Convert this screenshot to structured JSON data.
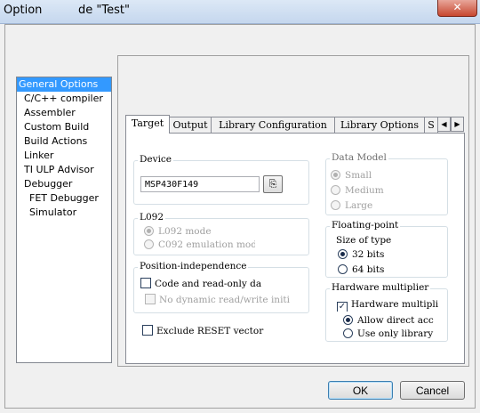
{
  "window": {
    "title_left": "Option",
    "title_right": "de \"Test\"",
    "close_glyph": "✕"
  },
  "categories": [
    {
      "label": "General Options",
      "selected": true
    },
    {
      "label": "C/C++ compiler"
    },
    {
      "label": "Assembler"
    },
    {
      "label": "Custom Build"
    },
    {
      "label": "Build Actions"
    },
    {
      "label": "Linker"
    },
    {
      "label": "TI ULP Advisor"
    },
    {
      "label": "Debugger"
    },
    {
      "label": "FET Debugger",
      "indent": true
    },
    {
      "label": "Simulator",
      "indent": true
    }
  ],
  "tabs": [
    "Target",
    "Output",
    "Library Configuration",
    "Library Options",
    "S"
  ],
  "tab_scroll": {
    "left": "◀",
    "right": "▶"
  },
  "device": {
    "legend": "Device",
    "value": "MSP430F149",
    "button_glyph": "⎘"
  },
  "l092": {
    "legend": "L092",
    "options": [
      "L092 mode",
      "C092 emulation mod"
    ]
  },
  "position_independence": {
    "legend": "Position-independence",
    "code_readonly": "Code and read-only da",
    "no_dynamic": "No dynamic read/write initi"
  },
  "exclude_reset": "Exclude RESET vector",
  "data_model": {
    "legend": "Data Model",
    "options": [
      "Small",
      "Medium",
      "Large"
    ]
  },
  "floating_point": {
    "legend": "Floating-point",
    "size_label": "Size of type",
    "options": [
      "32 bits",
      "64 bits"
    ]
  },
  "hardware_multiplier": {
    "legend": "Hardware multiplier",
    "checkbox": "Hardware multipli",
    "options": [
      "Allow direct acc",
      "Use only library"
    ]
  },
  "buttons": {
    "ok": "OK",
    "cancel": "Cancel"
  }
}
